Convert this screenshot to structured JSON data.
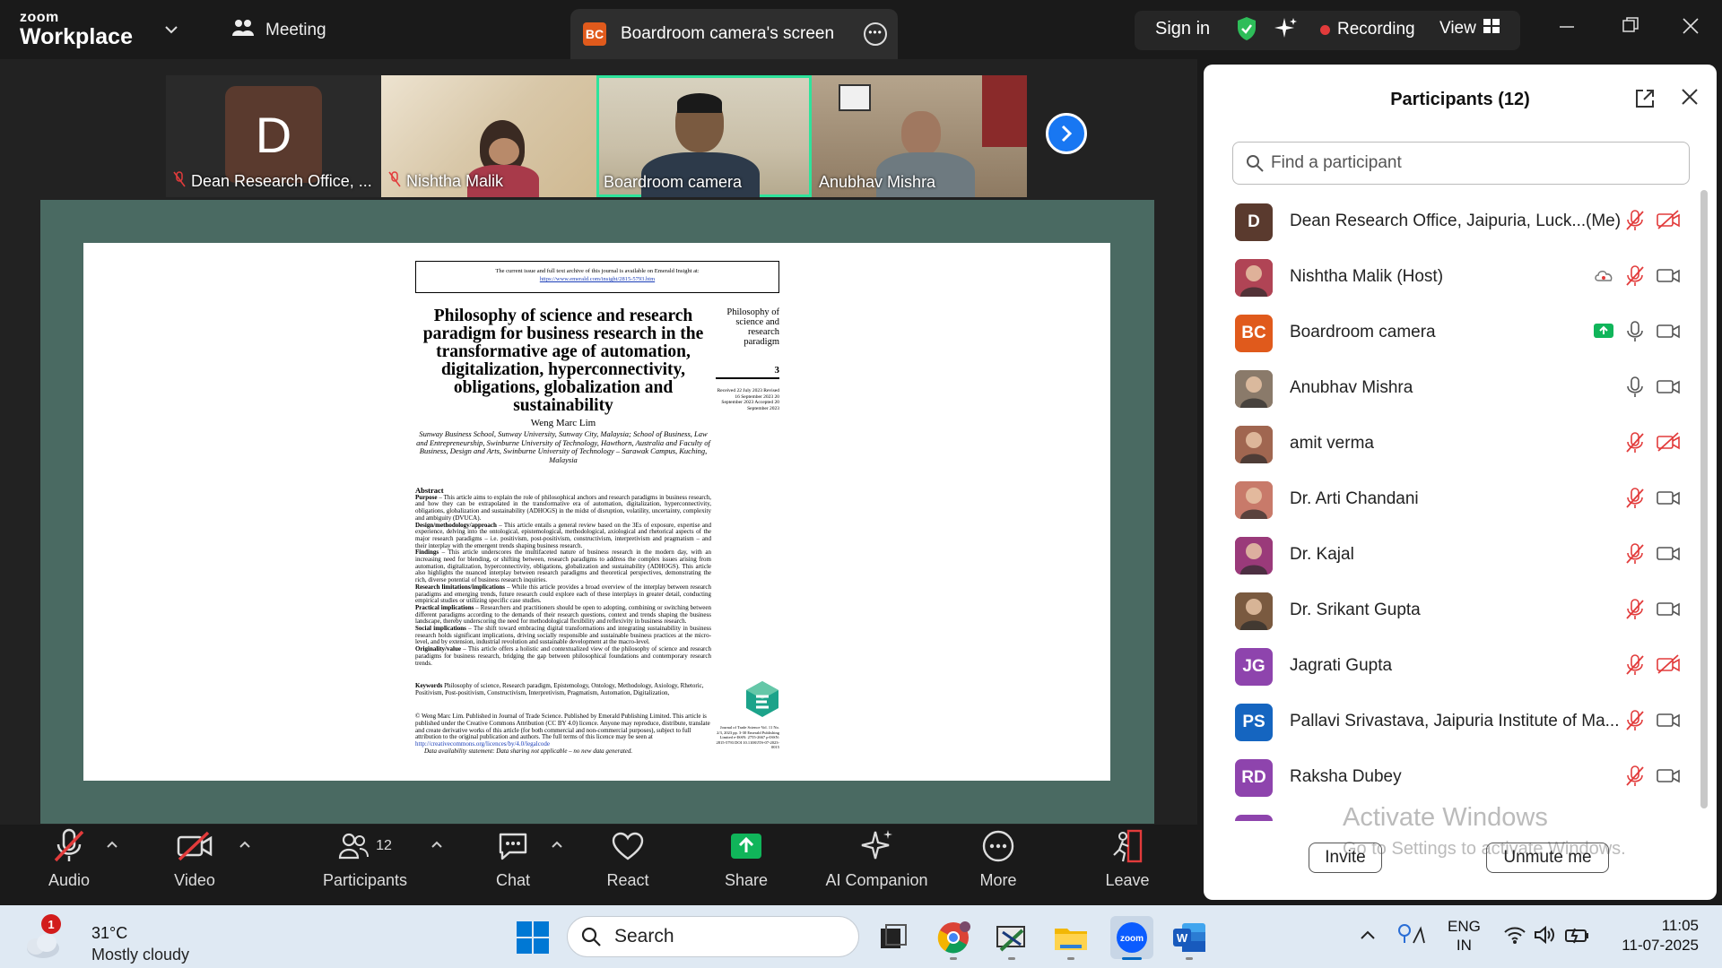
{
  "titlebar": {
    "logo_top": "zoom",
    "logo_bottom": "Workplace",
    "meeting_label": "Meeting",
    "screen_badge": "BC",
    "screen_tab_label": "Boardroom camera's screen",
    "sign_in": "Sign in",
    "recording": "Recording",
    "view": "View"
  },
  "thumbnails": [
    {
      "name": "Dean Research Office, ...",
      "initial": "D",
      "muted": true
    },
    {
      "name": "Nishtha Malik",
      "muted": true
    },
    {
      "name": "Boardroom camera",
      "muted": false,
      "active": true
    },
    {
      "name": "Anubhav Mishra",
      "muted": false
    }
  ],
  "document": {
    "header_line": "The current issue and full text archive of this journal is available on Emerald Insight at:",
    "header_url": "https://www.emerald.com/insight/2815-5793.htm",
    "title": "Philosophy of science and research paradigm for business research in the transformative age of automation, digitalization, hyperconnectivity, obligations, globalization and sustainability",
    "side_title": "Philosophy of science and research paradigm",
    "page_number": "3",
    "received": "Received 22 July 2023 Revised 16 September 2023 20 September 2023 Accepted 20 September 2023",
    "author": "Weng Marc Lim",
    "affiliation": "Sunway Business School, Sunway University, Sunway City, Malaysia; School of Business, Law and Entrepreneurship, Swinburne University of Technology, Hawthorn, Australia and Faculty of Business, Design and Arts, Swinburne University of Technology – Sarawak Campus, Kuching, Malaysia",
    "abstract_heading": "Abstract",
    "purpose_label": "Purpose",
    "purpose": " – This article aims to explain the role of philosophical anchors and research paradigms in business research, and how they can be extrapolated in the transformative era of automation, digitalization, hyperconnectivity, obligations, globalization and sustainability (ADHOGS) in the midst of disruption, volatility, uncertainty, complexity and ambiguity (DVUCA).",
    "design_label": "Design/methodology/approach",
    "design": " – This article entails a general review based on the 3Es of exposure, expertise and experience, delving into the ontological, epistemological, methodological, axiological and rhetorical aspects of the major research paradigms – i.e. positivism, post-positivism, constructivism, interpretivism and pragmatism – and their interplay with the emergent trends shaping business research.",
    "findings_label": "Findings",
    "findings": " – This article underscores the multifaceted nature of business research in the modern day, with an increasing need for blending, or shifting between, research paradigms to address the complex issues arising from automation, digitalization, hyperconnectivity, obligations, globalization and sustainability (ADHOGS). This article also highlights the nuanced interplay between research paradigms and theoretical perspectives, demonstrating the rich, diverse potential of business research inquiries.",
    "limitations_label": "Research limitations/implications",
    "limitations": " – While this article provides a broad overview of the interplay between research paradigms and emerging trends, future research could explore each of these interplays in greater detail, conducting empirical studies or utilizing specific case studies.",
    "practical_label": "Practical implications",
    "practical": " – Researchers and practitioners should be open to adopting, combining or switching between different paradigms according to the demands of their research questions, context and trends shaping the business landscape, thereby underscoring the need for methodological flexibility and reflexivity in business research.",
    "social_label": "Social implications",
    "social": " – The shift toward embracing digital transformations and integrating sustainability in business research holds significant implications, driving socially responsible and sustainable business practices at the micro-level, and by extension, industrial revolution and sustainable development at the macro-level.",
    "originality_label": "Originality/value",
    "originality": " – This article offers a holistic and contextualized view of the philosophy of science and research paradigms for business research, bridging the gap between philosophical foundations and contemporary research trends.",
    "keywords_label": "Keywords",
    "keywords": " Philosophy of science, Research paradigm, Epistemology, Ontology, Methodology, Axiology, Rhetoric, Positivism, Post-positivism, Constructivism, Interpretivism, Pragmatism, Automation, Digitalization,",
    "license": "© Weng Marc Lim. Published in Journal of Trade Science. Published by Emerald Publishing Limited. This article is published under the Creative Commons Attribution (CC BY 4.0) licence. Anyone may reproduce, distribute, translate and create derivative works of this article (for both commercial and non-commercial purposes), subject to full attribution to the original publication and authors. The full terms of this licence may be seen at",
    "license_url": " http://creativecommons.org/licences/by/4.0/legalcode",
    "data_statement": "Data availability statement: Data sharing not applicable – no new data generated.",
    "journal_info": "Journal of Trade Science Vol. 11 No. 2/3, 2023 pp. 3-30 Emerald Publishing Limited e-ISSN: 2755-2667 p-ISSN: 2815-5793 DOI 10.1108/JTS-07-2023-0015"
  },
  "toolbar": {
    "audio": "Audio",
    "video": "Video",
    "participants": "Participants",
    "participants_count": "12",
    "chat": "Chat",
    "react": "React",
    "share": "Share",
    "ai_companion": "AI Companion",
    "more": "More",
    "leave": "Leave"
  },
  "panel": {
    "title": "Participants (12)",
    "search_placeholder": "Find a participant",
    "participants": [
      {
        "name": "Dean Research Office, Jaipuria, Luck...",
        "initials": "D",
        "avatar_color": "#5a3a2e",
        "me": "(Me)",
        "mic": "muted",
        "cam": "off"
      },
      {
        "name": "Nishtha Malik (Host)",
        "initials": "",
        "avatar_color": "#b04455",
        "mic": "muted",
        "cam": "on",
        "extra": "cloud"
      },
      {
        "name": "Boardroom camera",
        "initials": "BC",
        "avatar_color": "#e05a1c",
        "mic": "on",
        "cam": "on",
        "extra": "share"
      },
      {
        "name": "Anubhav Mishra",
        "initials": "",
        "avatar_color": "#8a7a6a",
        "mic": "on",
        "cam": "on"
      },
      {
        "name": "amit verma",
        "initials": "",
        "avatar_color": "#a06650",
        "mic": "muted",
        "cam": "off"
      },
      {
        "name": "Dr. Arti Chandani",
        "initials": "",
        "avatar_color": "#c87a6a",
        "mic": "muted",
        "cam": "on"
      },
      {
        "name": "Dr. Kajal",
        "initials": "",
        "avatar_color": "#9a3a7a",
        "mic": "muted",
        "cam": "on"
      },
      {
        "name": "Dr. Srikant Gupta",
        "initials": "",
        "avatar_color": "#7a5a40",
        "mic": "muted",
        "cam": "on"
      },
      {
        "name": "Jagrati Gupta",
        "initials": "JG",
        "avatar_color": "#8e44ad",
        "mic": "muted",
        "cam": "off"
      },
      {
        "name": "Pallavi Srivastava, Jaipuria Institute of Ma...",
        "initials": "PS",
        "avatar_color": "#1565c0",
        "mic": "muted",
        "cam": "on"
      },
      {
        "name": "Raksha Dubey",
        "initials": "RD",
        "avatar_color": "#8e44ad",
        "mic": "muted",
        "cam": "on"
      }
    ],
    "watermark_line1": "Activate Windows",
    "watermark_line2": "Go to Settings to activate Windows.",
    "invite": "Invite",
    "unmute_me": "Unmute me"
  },
  "taskbar": {
    "notification_count": "1",
    "temperature": "31°C",
    "weather": "Mostly cloudy",
    "search": "Search",
    "lang_line1": "ENG",
    "lang_line2": "IN",
    "time": "11:05",
    "date": "11-07-2025"
  },
  "colors": {
    "accent_green": "#2ee39b",
    "share_green": "#10b55a",
    "muted_red": "#e23b3b",
    "zoom_blue": "#0b5cff"
  }
}
